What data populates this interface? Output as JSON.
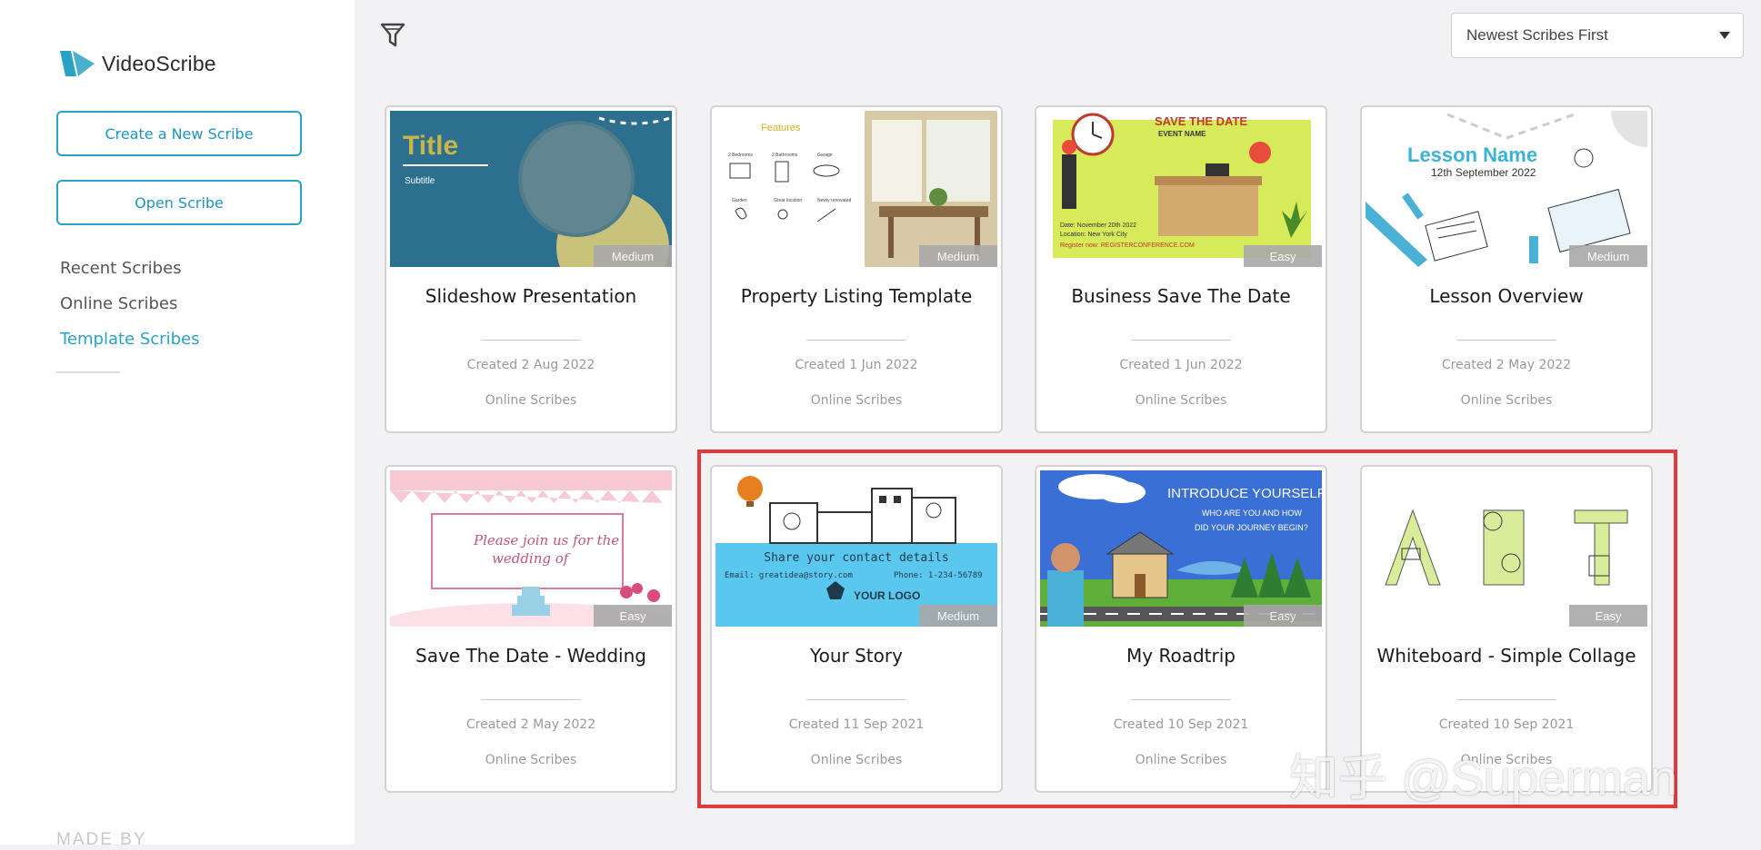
{
  "app": {
    "name": "VideoScribe"
  },
  "sidebar": {
    "create_label": "Create a New Scribe",
    "open_label": "Open Scribe",
    "nav": [
      {
        "label": "Recent Scribes",
        "active": false
      },
      {
        "label": "Online Scribes",
        "active": false
      },
      {
        "label": "Template Scribes",
        "active": true
      }
    ],
    "made_by": "MADE BY"
  },
  "toolbar": {
    "filter_icon": "filter-icon",
    "sort_value": "Newest Scribes First"
  },
  "cards": [
    {
      "title": "Slideshow Presentation",
      "created": "Created 2 Aug 2022",
      "location": "Online Scribes",
      "difficulty": "Medium",
      "thumb": {
        "title": "Title",
        "subtitle": "Subtitle"
      }
    },
    {
      "title": "Property Listing Template",
      "created": "Created 1 Jun 2022",
      "location": "Online Scribes",
      "difficulty": "Medium",
      "thumb": {
        "heading": "Features",
        "items": [
          "2 Bedrooms",
          "2 Bathrooms",
          "Garage",
          "Garden",
          "Great location",
          "Newly renovated"
        ]
      }
    },
    {
      "title": "Business Save The Date",
      "created": "Created 1 Jun 2022",
      "location": "Online Scribes",
      "difficulty": "Easy",
      "thumb": {
        "heading": "SAVE THE DATE",
        "sub": "EVENT NAME",
        "lines": [
          "Date: November 20th 2022",
          "Location: New York City",
          "Register now: REGISTERCONFERENCE.COM"
        ]
      }
    },
    {
      "title": "Lesson Overview",
      "created": "Created 2 May 2022",
      "location": "Online Scribes",
      "difficulty": "Medium",
      "thumb": {
        "heading": "Lesson Name",
        "sub": "12th September 2022"
      }
    },
    {
      "title": "Save The Date - Wedding",
      "created": "Created 2 May 2022",
      "location": "Online Scribes",
      "difficulty": "Easy",
      "thumb": {
        "lines": [
          "Please join us for the",
          "wedding of"
        ]
      }
    },
    {
      "title": "Your Story",
      "created": "Created 11 Sep 2021",
      "location": "Online Scribes",
      "difficulty": "Medium",
      "thumb": {
        "heading": "Share your contact details",
        "line": "Email: greatidea@story.com",
        "phone": "Phone: 1-234-56789",
        "logo": "YOUR LOGO"
      }
    },
    {
      "title": "My Roadtrip",
      "created": "Created 10 Sep 2021",
      "location": "Online Scribes",
      "difficulty": "Easy",
      "thumb": {
        "heading": "INTRODUCE YOURSELF!",
        "lines": [
          "WHO ARE YOU AND HOW",
          "DID YOUR JOURNEY BEGIN?"
        ]
      }
    },
    {
      "title": "Whiteboard - Simple Collage",
      "created": "Created 10 Sep 2021",
      "location": "Online Scribes",
      "difficulty": "Easy",
      "thumb": {}
    }
  ],
  "watermark": "知乎 @Superman"
}
